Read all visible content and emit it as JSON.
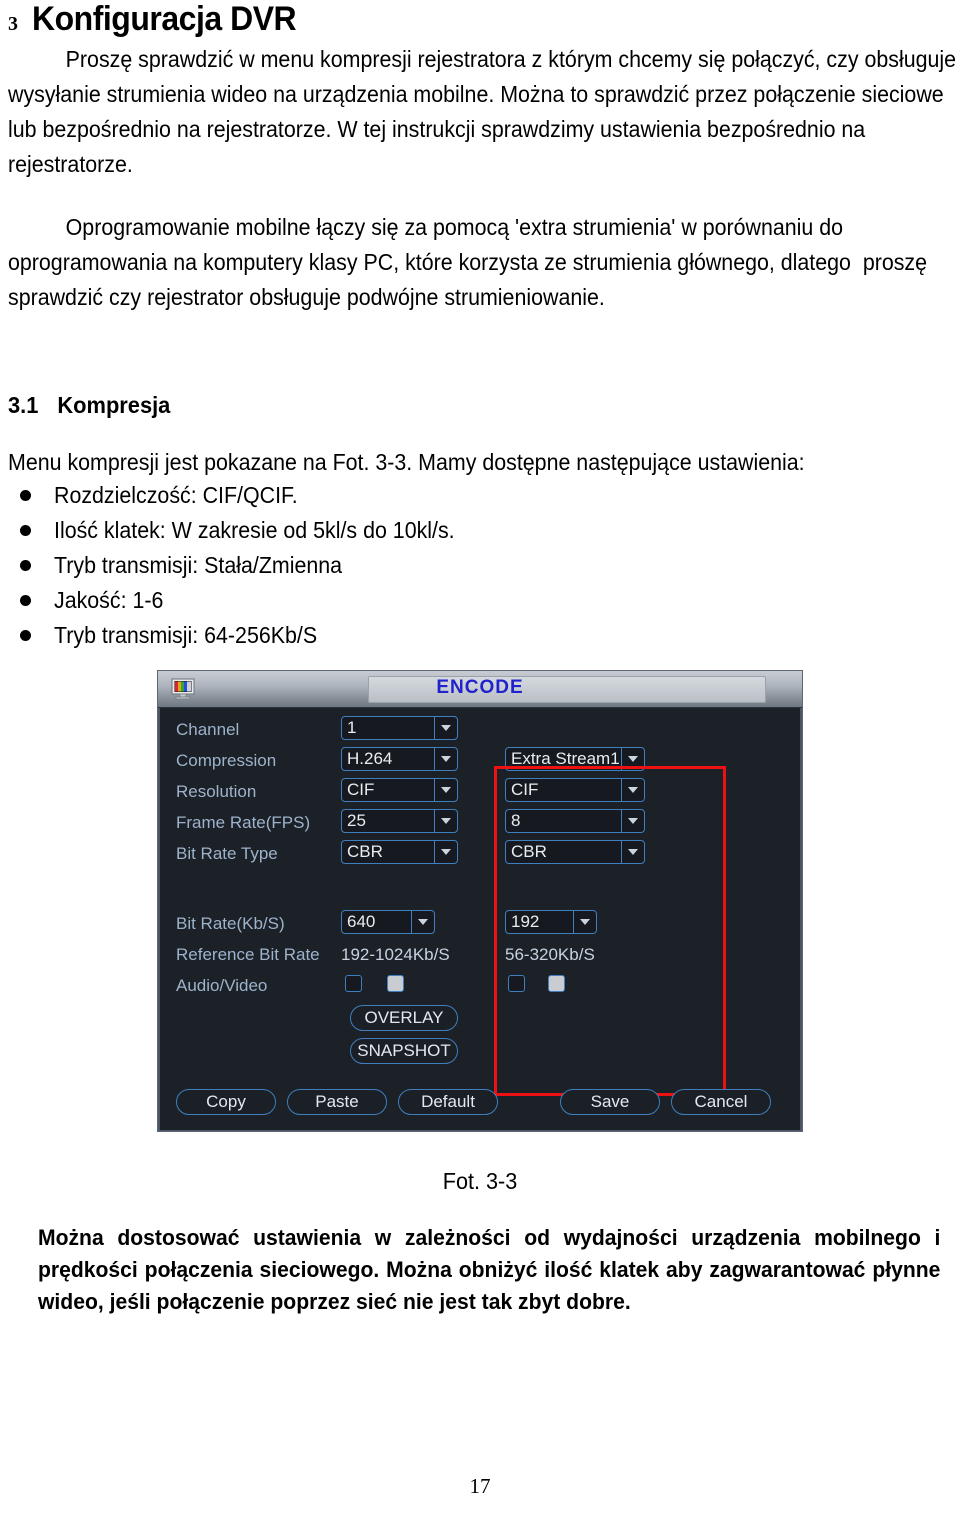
{
  "document": {
    "heading": {
      "number": "3",
      "title": "Konfiguracja DVR"
    },
    "paragraph_1": "Proszę sprawdzić w menu kompresji rejestratora z którym chcemy się połączyć, czy obsługuje wysyłanie strumienia wideo na urządzenia mobilne. Można to sprawdzić przez połączenie sieciowe lub bezpośrednio na rejestratorze. W tej instrukcji sprawdzimy ustawienia bezpośrednio na rejestratorze.",
    "paragraph_2": "Oprogramowanie mobilne łączy się za pomocą 'extra strumienia' w porównaniu do oprogramowania na komputery klasy PC, które korzysta ze strumienia głównego, dlatego  proszę sprawdzić czy rejestrator obsługuje podwójne strumieniowanie.",
    "subheading": {
      "number": "3.1",
      "title": "Kompresja"
    },
    "paragraph_3": "Menu kompresji jest pokazane na Fot. 3-3. Mamy dostępne następujące ustawienia:",
    "bullets": [
      "Rozdzielczość: CIF/QCIF.",
      "Ilość klatek: W zakresie od 5kl/s do 10kl/s.",
      "Tryb transmisji: Stała/Zmienna",
      "Jakość: 1-6",
      "Tryb transmisji: 64-256Kb/S"
    ],
    "figure_caption": "Fot. 3-3",
    "paragraph_4": "Można dostosować ustawienia w zależności od wydajności urządzenia mobilnego i prędkości połączenia sieciowego. Można obniżyć ilość klatek aby zagwarantować płynne wideo, jeśli połączenie poprzez sieć nie jest tak zbyt dobre.",
    "page_number": "17"
  },
  "dvr_dialog": {
    "title": "ENCODE",
    "icon": "monitor-icon",
    "rows": {
      "channel": {
        "label": "Channel",
        "main_value": "1"
      },
      "compression": {
        "label": "Compression",
        "main_value": "H.264",
        "extra_value": "Extra Stream1"
      },
      "resolution": {
        "label": "Resolution",
        "main_value": "CIF",
        "extra_value": "CIF"
      },
      "frame_rate": {
        "label": "Frame Rate(FPS)",
        "main_value": "25",
        "extra_value": "8"
      },
      "bit_rate_type": {
        "label": "Bit Rate Type",
        "main_value": "CBR",
        "extra_value": "CBR"
      },
      "bit_rate": {
        "label": "Bit Rate(Kb/S)",
        "main_value": "640",
        "extra_value": "192"
      },
      "reference_bit_rate": {
        "label": "Reference Bit Rate",
        "main_value": "192-1024Kb/S",
        "extra_value": "56-320Kb/S"
      },
      "audio_video": {
        "label": "Audio/Video"
      }
    },
    "side_buttons": {
      "overlay": "OVERLAY",
      "snapshot": "SNAPSHOT"
    },
    "footer_buttons": {
      "copy": "Copy",
      "paste": "Paste",
      "default": "Default",
      "save": "Save",
      "cancel": "Cancel"
    },
    "highlight_color": "#ee1111",
    "accent_color": "#3f7fbf",
    "title_color": "#2222cc"
  }
}
